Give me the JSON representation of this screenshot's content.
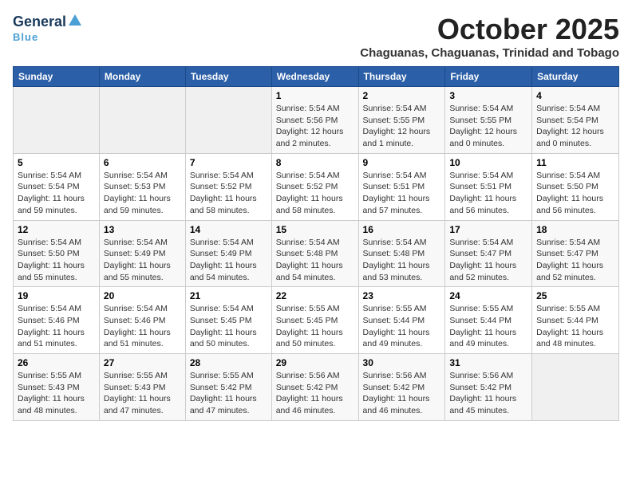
{
  "header": {
    "logo_general": "General",
    "logo_blue": "Blue",
    "month": "October 2025",
    "subtitle": "Chaguanas, Chaguanas, Trinidad and Tobago"
  },
  "days_of_week": [
    "Sunday",
    "Monday",
    "Tuesday",
    "Wednesday",
    "Thursday",
    "Friday",
    "Saturday"
  ],
  "weeks": [
    [
      {
        "day": "",
        "info": ""
      },
      {
        "day": "",
        "info": ""
      },
      {
        "day": "",
        "info": ""
      },
      {
        "day": "1",
        "info": "Sunrise: 5:54 AM\nSunset: 5:56 PM\nDaylight: 12 hours\nand 2 minutes."
      },
      {
        "day": "2",
        "info": "Sunrise: 5:54 AM\nSunset: 5:55 PM\nDaylight: 12 hours\nand 1 minute."
      },
      {
        "day": "3",
        "info": "Sunrise: 5:54 AM\nSunset: 5:55 PM\nDaylight: 12 hours\nand 0 minutes."
      },
      {
        "day": "4",
        "info": "Sunrise: 5:54 AM\nSunset: 5:54 PM\nDaylight: 12 hours\nand 0 minutes."
      }
    ],
    [
      {
        "day": "5",
        "info": "Sunrise: 5:54 AM\nSunset: 5:54 PM\nDaylight: 11 hours\nand 59 minutes."
      },
      {
        "day": "6",
        "info": "Sunrise: 5:54 AM\nSunset: 5:53 PM\nDaylight: 11 hours\nand 59 minutes."
      },
      {
        "day": "7",
        "info": "Sunrise: 5:54 AM\nSunset: 5:52 PM\nDaylight: 11 hours\nand 58 minutes."
      },
      {
        "day": "8",
        "info": "Sunrise: 5:54 AM\nSunset: 5:52 PM\nDaylight: 11 hours\nand 58 minutes."
      },
      {
        "day": "9",
        "info": "Sunrise: 5:54 AM\nSunset: 5:51 PM\nDaylight: 11 hours\nand 57 minutes."
      },
      {
        "day": "10",
        "info": "Sunrise: 5:54 AM\nSunset: 5:51 PM\nDaylight: 11 hours\nand 56 minutes."
      },
      {
        "day": "11",
        "info": "Sunrise: 5:54 AM\nSunset: 5:50 PM\nDaylight: 11 hours\nand 56 minutes."
      }
    ],
    [
      {
        "day": "12",
        "info": "Sunrise: 5:54 AM\nSunset: 5:50 PM\nDaylight: 11 hours\nand 55 minutes."
      },
      {
        "day": "13",
        "info": "Sunrise: 5:54 AM\nSunset: 5:49 PM\nDaylight: 11 hours\nand 55 minutes."
      },
      {
        "day": "14",
        "info": "Sunrise: 5:54 AM\nSunset: 5:49 PM\nDaylight: 11 hours\nand 54 minutes."
      },
      {
        "day": "15",
        "info": "Sunrise: 5:54 AM\nSunset: 5:48 PM\nDaylight: 11 hours\nand 54 minutes."
      },
      {
        "day": "16",
        "info": "Sunrise: 5:54 AM\nSunset: 5:48 PM\nDaylight: 11 hours\nand 53 minutes."
      },
      {
        "day": "17",
        "info": "Sunrise: 5:54 AM\nSunset: 5:47 PM\nDaylight: 11 hours\nand 52 minutes."
      },
      {
        "day": "18",
        "info": "Sunrise: 5:54 AM\nSunset: 5:47 PM\nDaylight: 11 hours\nand 52 minutes."
      }
    ],
    [
      {
        "day": "19",
        "info": "Sunrise: 5:54 AM\nSunset: 5:46 PM\nDaylight: 11 hours\nand 51 minutes."
      },
      {
        "day": "20",
        "info": "Sunrise: 5:54 AM\nSunset: 5:46 PM\nDaylight: 11 hours\nand 51 minutes."
      },
      {
        "day": "21",
        "info": "Sunrise: 5:54 AM\nSunset: 5:45 PM\nDaylight: 11 hours\nand 50 minutes."
      },
      {
        "day": "22",
        "info": "Sunrise: 5:55 AM\nSunset: 5:45 PM\nDaylight: 11 hours\nand 50 minutes."
      },
      {
        "day": "23",
        "info": "Sunrise: 5:55 AM\nSunset: 5:44 PM\nDaylight: 11 hours\nand 49 minutes."
      },
      {
        "day": "24",
        "info": "Sunrise: 5:55 AM\nSunset: 5:44 PM\nDaylight: 11 hours\nand 49 minutes."
      },
      {
        "day": "25",
        "info": "Sunrise: 5:55 AM\nSunset: 5:44 PM\nDaylight: 11 hours\nand 48 minutes."
      }
    ],
    [
      {
        "day": "26",
        "info": "Sunrise: 5:55 AM\nSunset: 5:43 PM\nDaylight: 11 hours\nand 48 minutes."
      },
      {
        "day": "27",
        "info": "Sunrise: 5:55 AM\nSunset: 5:43 PM\nDaylight: 11 hours\nand 47 minutes."
      },
      {
        "day": "28",
        "info": "Sunrise: 5:55 AM\nSunset: 5:42 PM\nDaylight: 11 hours\nand 47 minutes."
      },
      {
        "day": "29",
        "info": "Sunrise: 5:56 AM\nSunset: 5:42 PM\nDaylight: 11 hours\nand 46 minutes."
      },
      {
        "day": "30",
        "info": "Sunrise: 5:56 AM\nSunset: 5:42 PM\nDaylight: 11 hours\nand 46 minutes."
      },
      {
        "day": "31",
        "info": "Sunrise: 5:56 AM\nSunset: 5:42 PM\nDaylight: 11 hours\nand 45 minutes."
      },
      {
        "day": "",
        "info": ""
      }
    ]
  ]
}
